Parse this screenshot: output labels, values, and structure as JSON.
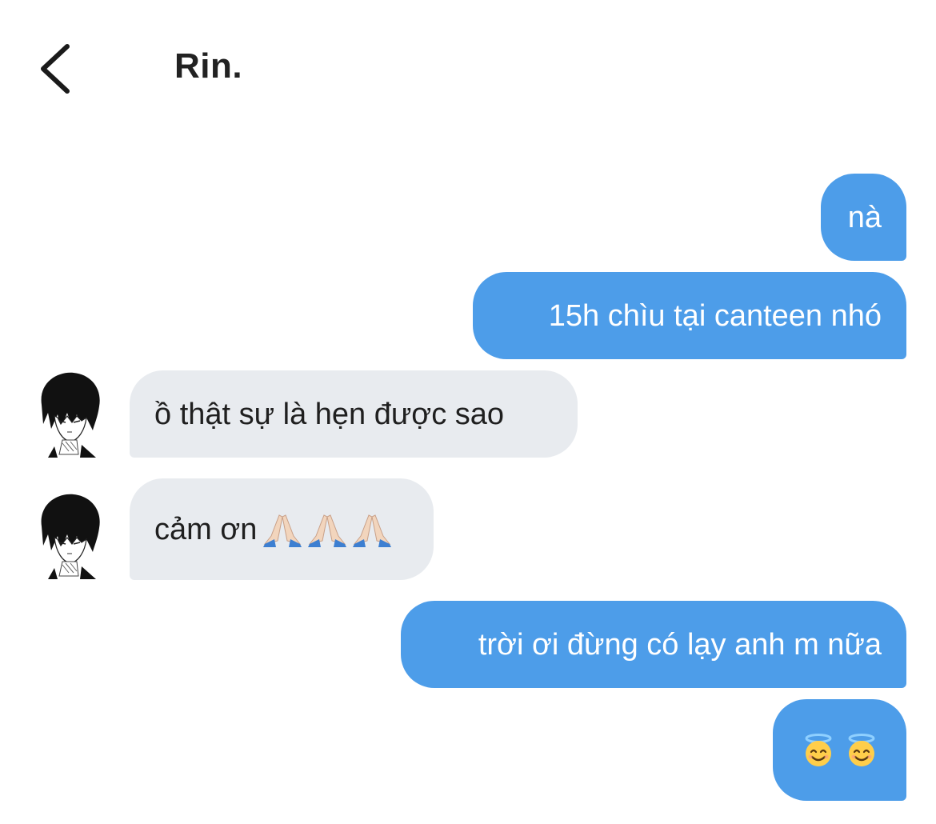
{
  "header": {
    "title": "Rin."
  },
  "messages": [
    {
      "side": "sent",
      "text": "nà"
    },
    {
      "side": "sent",
      "text": "15h chìu tại canteen nhó"
    },
    {
      "side": "received",
      "text": "ồ thật sự là hẹn được sao"
    },
    {
      "side": "received",
      "text": "cảm ơn",
      "emoji": [
        "folded-hands-emoji",
        "folded-hands-emoji",
        "folded-hands-emoji"
      ]
    },
    {
      "side": "sent",
      "text": "trời ơi đừng có lạy anh m nữa"
    },
    {
      "side": "sent",
      "text": "",
      "emoji": [
        "smiling-face-with-halo-emoji",
        "smiling-face-with-halo-emoji"
      ]
    }
  ],
  "colors": {
    "sent_bubble": "#4d9de9",
    "received_bubble": "#e8ebef",
    "sent_text": "#ffffff",
    "received_text": "#1f1f1f"
  },
  "icons": {
    "back": "chevron-left-icon",
    "avatar": "contact-avatar"
  }
}
